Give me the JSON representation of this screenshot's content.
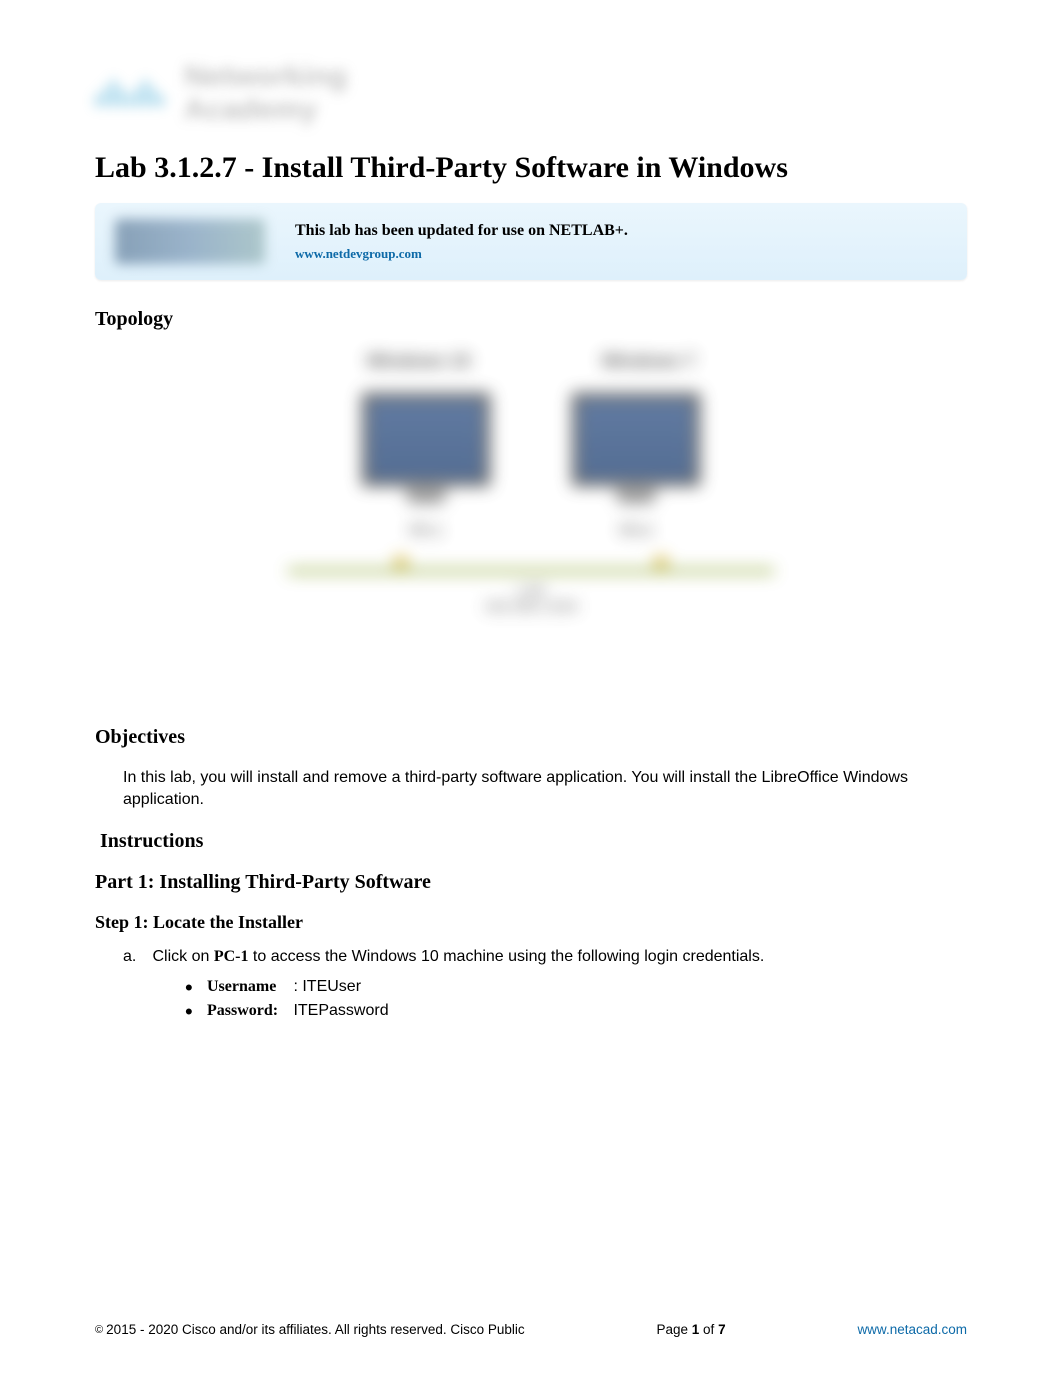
{
  "header": {
    "logo_text_line1": "Networking",
    "logo_text_line2": "Academy"
  },
  "title": "Lab 3.1.2.7 - Install Third-Party Software in Windows",
  "notice": {
    "text": "This lab has been updated for use on NETLAB+.",
    "link": "www.netdevgroup.com"
  },
  "sections": {
    "topology_heading": "Topology",
    "topology": {
      "label1": "Windows 10",
      "label2": "Windows 7",
      "pc1": "PC-1",
      "pc2": "PC-2",
      "lan": "LAN",
      "subnet": "192.168.1.0/24"
    },
    "objectives_heading": "Objectives",
    "objectives_text": "In this lab, you will install and remove a third-party software application. You will install the LibreOffice Windows application.",
    "instructions_heading": "Instructions",
    "part1_heading": "Part 1: Installing Third-Party Software",
    "step1_heading": "Step 1: Locate the Installer",
    "step1": {
      "letter": "a.",
      "pre": "Click on ",
      "bold": "PC-1",
      "post": " to access the Windows 10 machine using the following login credentials.",
      "creds": [
        {
          "label": "Username",
          "sep": " : ",
          "value": "ITEUser"
        },
        {
          "label": "Password:",
          "sep": "   ",
          "value": "ITEPassword"
        }
      ]
    }
  },
  "footer": {
    "copyright": "2015 - 2020 Cisco and/or its affiliates. All rights reserved. Cisco Public",
    "page_pre": "Page ",
    "page_cur": "1",
    "page_mid": " of ",
    "page_total": "7",
    "url": "www.netacad.com"
  }
}
